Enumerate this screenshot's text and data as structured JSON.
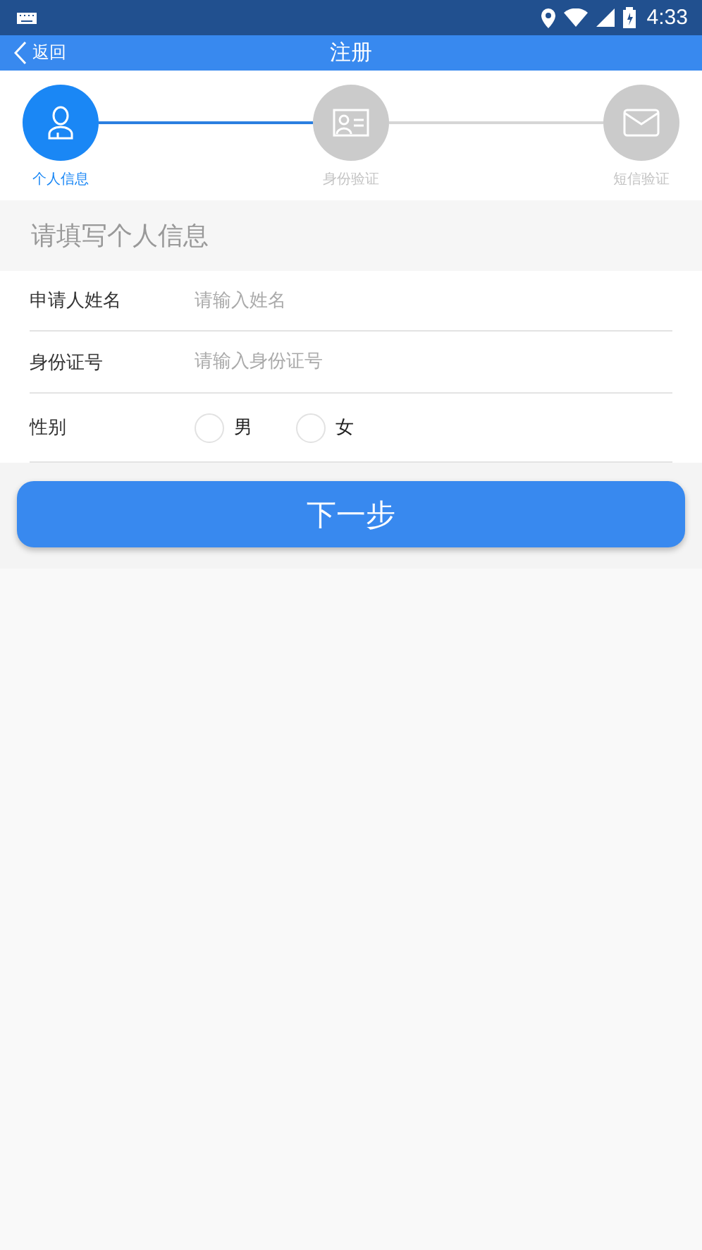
{
  "status_bar": {
    "time": "4:33"
  },
  "nav": {
    "back": "返回",
    "title": "注册"
  },
  "steps": [
    {
      "label": "个人信息",
      "kind": "person",
      "selected": true
    },
    {
      "label": "身份验证",
      "kind": "id-card",
      "selected": false
    },
    {
      "label": "短信验证",
      "kind": "mail",
      "selected": false
    }
  ],
  "section_title": "请填写个人信息",
  "fields": [
    {
      "label": "申请人姓名",
      "placeholder": "请输入姓名"
    },
    {
      "label": "身份证号",
      "placeholder": "请输入身份证号"
    }
  ],
  "gender": {
    "label": "性别",
    "options": [
      {
        "label": "男",
        "selected": false
      },
      {
        "label": "女",
        "selected": false
      }
    ]
  },
  "next_button": "下一步"
}
